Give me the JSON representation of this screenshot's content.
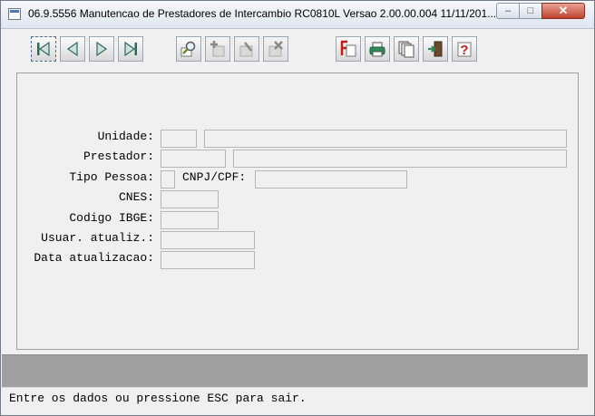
{
  "window": {
    "title": "06.9.5556  Manutencao de Prestadores de Intercambio RC0810L Versao 2.00.00.004 11/11/201..."
  },
  "toolbar": {
    "buttons": [
      {
        "name": "first-record-button",
        "icon": "first-icon"
      },
      {
        "name": "previous-record-button",
        "icon": "prev-icon"
      },
      {
        "name": "next-record-button",
        "icon": "next-icon"
      },
      {
        "name": "last-record-button",
        "icon": "last-icon"
      },
      {
        "name": "search-button",
        "icon": "magnifier-icon"
      },
      {
        "name": "add-button",
        "icon": "add-icon"
      },
      {
        "name": "edit-button",
        "icon": "edit-icon"
      },
      {
        "name": "delete-button",
        "icon": "delete-icon"
      },
      {
        "name": "filter-button",
        "icon": "f-filter-icon"
      },
      {
        "name": "print-button",
        "icon": "printer-icon"
      },
      {
        "name": "copy-button",
        "icon": "copy-pages-icon"
      },
      {
        "name": "exit-button",
        "icon": "exit-door-icon"
      },
      {
        "name": "help-button",
        "icon": "help-icon"
      }
    ]
  },
  "form": {
    "unidade_label": "Unidade:",
    "prestador_label": "Prestador:",
    "tipo_pessoa_label": "Tipo Pessoa:",
    "cnpj_cpf_label": "CNPJ/CPF:",
    "cnes_label": "CNES:",
    "codigo_ibge_label": "Codigo IBGE:",
    "usuar_atualiz_label": "Usuar. atualiz.:",
    "data_atualizacao_label": "Data atualizacao:"
  },
  "status": {
    "message": "Entre os dados ou pressione ESC para sair."
  },
  "colors": {
    "background": "#f0f0f0",
    "status_bar": "#a0a0a0",
    "field_border": "#b6b6b6"
  }
}
